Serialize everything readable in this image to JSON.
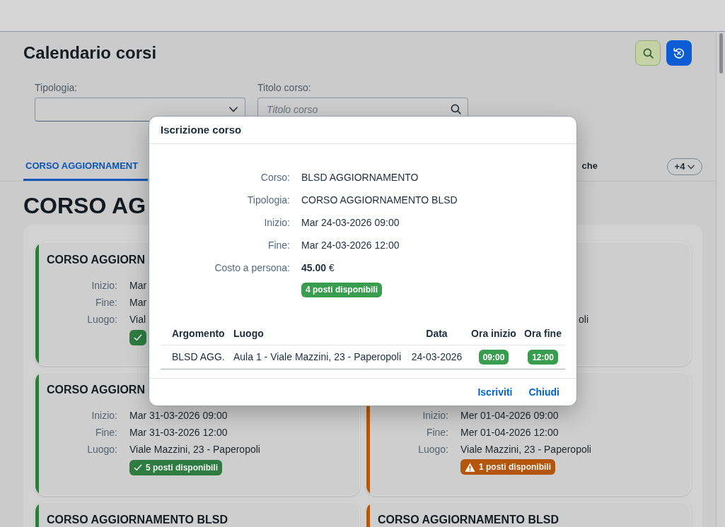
{
  "page": {
    "title": "Calendario corsi"
  },
  "filters": [
    {
      "kind": "select",
      "label": "Tipologia:"
    },
    {
      "kind": "search",
      "label": "Titolo corso:",
      "placeholder": "Titolo corso"
    }
  ],
  "tabs": [
    {
      "label": "CORSO AGGIORNAMENT",
      "selected": true
    },
    {
      "label": "che",
      "selected": false
    }
  ],
  "more_tabs": "+4",
  "section_title": "CORSO AG",
  "cards": [
    {
      "color": "#2e7b3e",
      "title": "CORSO AGGIORN",
      "fields": [
        {
          "label": "Inizio:",
          "value": "Mar"
        },
        {
          "label": "Fine:",
          "value": "Mar"
        },
        {
          "label": "Luogo:",
          "value": "Vial"
        }
      ],
      "badge": {
        "kind": "ok"
      }
    },
    {
      "fragment": "oli"
    },
    {
      "color": "#2e7b3e",
      "title": "CORSO AGGIORN",
      "fields": [
        {
          "label": "Inizio:",
          "value": "Mar 31-03-2026 09:00"
        },
        {
          "label": "Fine:",
          "value": "Mar 31-03-2026 12:00"
        },
        {
          "label": "Luogo:",
          "value": "Viale Mazzini, 23 - Paperopoli"
        }
      ],
      "badge": {
        "kind": "ok",
        "text": "5 posti disponibili"
      }
    },
    {
      "color": "#b3570c",
      "fields": [
        {
          "label": "Inizio:",
          "value": "Mer 01-04-2026 09:00"
        },
        {
          "label": "Fine:",
          "value": "Mer 01-04-2026 12:00"
        },
        {
          "label": "Luogo:",
          "value": "Viale Mazzini, 23 - Paperopoli"
        }
      ],
      "badge": {
        "kind": "warning",
        "text": "1 posti disponibili"
      }
    },
    {
      "color": "#2e7b3e",
      "title": "CORSO AGGIORNAMENTO BLSD"
    },
    {
      "color": "#b3570c",
      "title": "CORSO AGGIORNAMENTO BLSD"
    }
  ],
  "dialog": {
    "title": "Iscrizione corso",
    "details": [
      {
        "label": "Corso:",
        "value": "BLSD AGGIORNAMENTO"
      },
      {
        "label": "Tipologia:",
        "value": "CORSO AGGIORNAMENTO BLSD"
      },
      {
        "label": "Inizio:",
        "value": "Mar 24-03-2026 09:00"
      },
      {
        "label": "Fine:",
        "value": "Mar 24-03-2026 12:00"
      },
      {
        "label": "Costo a persona:",
        "value": "**45.00** €"
      }
    ],
    "availability": "4 posti disponibili",
    "table": {
      "columns": [
        {
          "label": "Argomento",
          "kind": "text"
        },
        {
          "label": "Luogo",
          "kind": "text"
        },
        {
          "label": "Data",
          "kind": "date"
        },
        {
          "label": "Ora inizio",
          "kind": "time"
        },
        {
          "label": "Ora fine",
          "kind": "time"
        }
      ],
      "rows": [
        [
          "BLSD AGG.",
          "Aula 1 - Viale Mazzini, 23 - Paperopoli",
          "24-03-2026",
          "09:00",
          "12:00"
        ]
      ]
    },
    "buttons": [
      "Iscriviti",
      "Chiudi"
    ]
  }
}
